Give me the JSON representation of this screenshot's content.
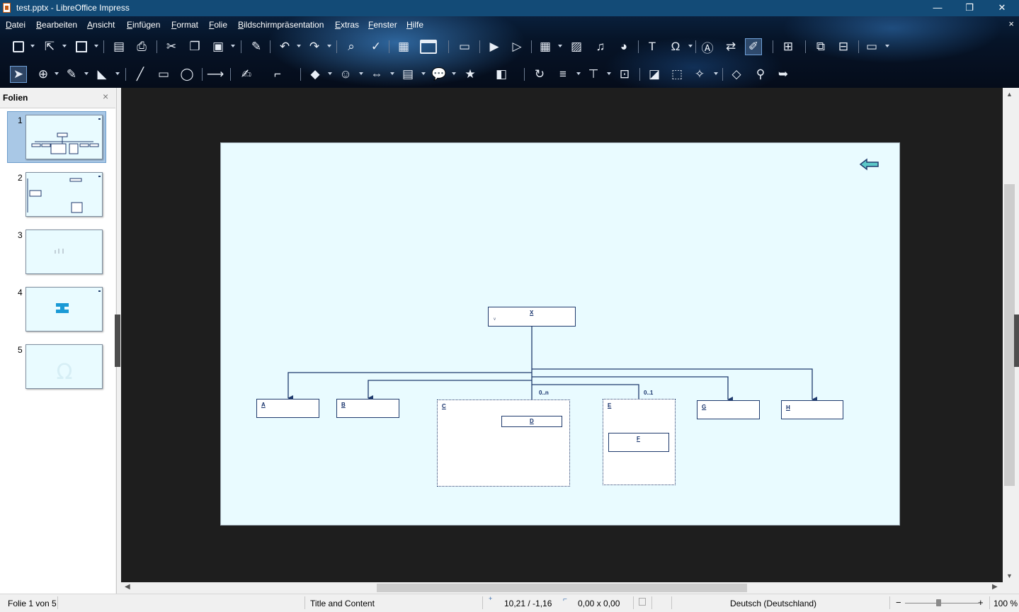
{
  "window": {
    "title": "test.pptx - LibreOffice Impress",
    "minimize": "—",
    "maximize": "❐",
    "close": "✕"
  },
  "menu": {
    "items": [
      "Datei",
      "Bearbeiten",
      "Ansicht",
      "Einfügen",
      "Format",
      "Folie",
      "Bildschirmpräsentation",
      "Extras",
      "Fenster",
      "Hilfe"
    ],
    "close_doc": "×"
  },
  "slide_pane": {
    "title": "Folien",
    "close": "×",
    "slides": [
      {
        "number": "1",
        "selected": true
      },
      {
        "number": "2"
      },
      {
        "number": "3"
      },
      {
        "number": "4"
      },
      {
        "number": "5"
      }
    ]
  },
  "diagram": {
    "boxes": [
      {
        "id": "X",
        "label": "X",
        "sub": "v"
      },
      {
        "id": "A",
        "label": "A"
      },
      {
        "id": "B",
        "label": "B"
      },
      {
        "id": "C",
        "label": "C"
      },
      {
        "id": "D",
        "label": "D"
      },
      {
        "id": "E",
        "label": "E"
      },
      {
        "id": "F",
        "label": "F"
      },
      {
        "id": "G",
        "label": "G"
      },
      {
        "id": "H",
        "label": "H"
      }
    ],
    "multiplicities": [
      "0..n",
      "0..1"
    ]
  },
  "status": {
    "slide": "Folie 1 von 5",
    "layout": "Title and Content",
    "position": "10,21 / -1,16",
    "size": "0,00 x 0,00",
    "language": "Deutsch (Deutschland)",
    "zoom": "100 %",
    "zoom_minus": "−",
    "zoom_plus": "+"
  },
  "colors": {
    "slide_background": "#e9fbff",
    "diagram_line": "#1f3a6d",
    "workspace": "#1e1e1e",
    "titlebar": "#134b77"
  }
}
